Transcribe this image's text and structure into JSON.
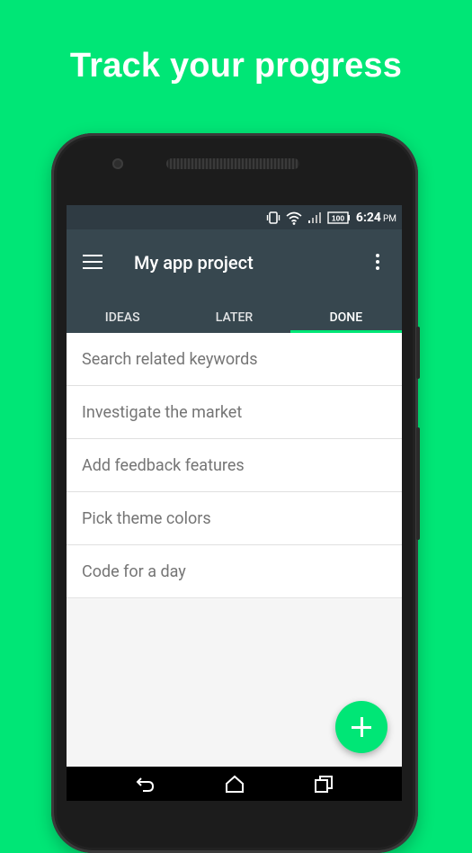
{
  "headline": "Track your progress",
  "status_bar": {
    "time": "6:24",
    "ampm": "PM",
    "battery": "100",
    "icons": [
      "vibrate-icon",
      "wifi-icon",
      "signal-icon",
      "battery-icon"
    ]
  },
  "app_bar": {
    "title": "My app project",
    "menu_icon": "hamburger-menu-icon",
    "overflow_icon": "more-vert-icon"
  },
  "tabs": [
    {
      "label": "IDEAS",
      "active": false
    },
    {
      "label": "LATER",
      "active": false
    },
    {
      "label": "DONE",
      "active": true
    }
  ],
  "list_items": [
    "Search related keywords",
    "Investigate the market",
    "Add feedback features",
    "Pick theme colors",
    "Code for a day"
  ],
  "fab_icon": "add-icon",
  "nav_icons": [
    "back-icon",
    "home-icon",
    "recents-icon"
  ],
  "colors": {
    "background": "#00e676",
    "accent": "#00e676",
    "app_bar": "#37474f",
    "status_bar": "#2f3b43"
  }
}
